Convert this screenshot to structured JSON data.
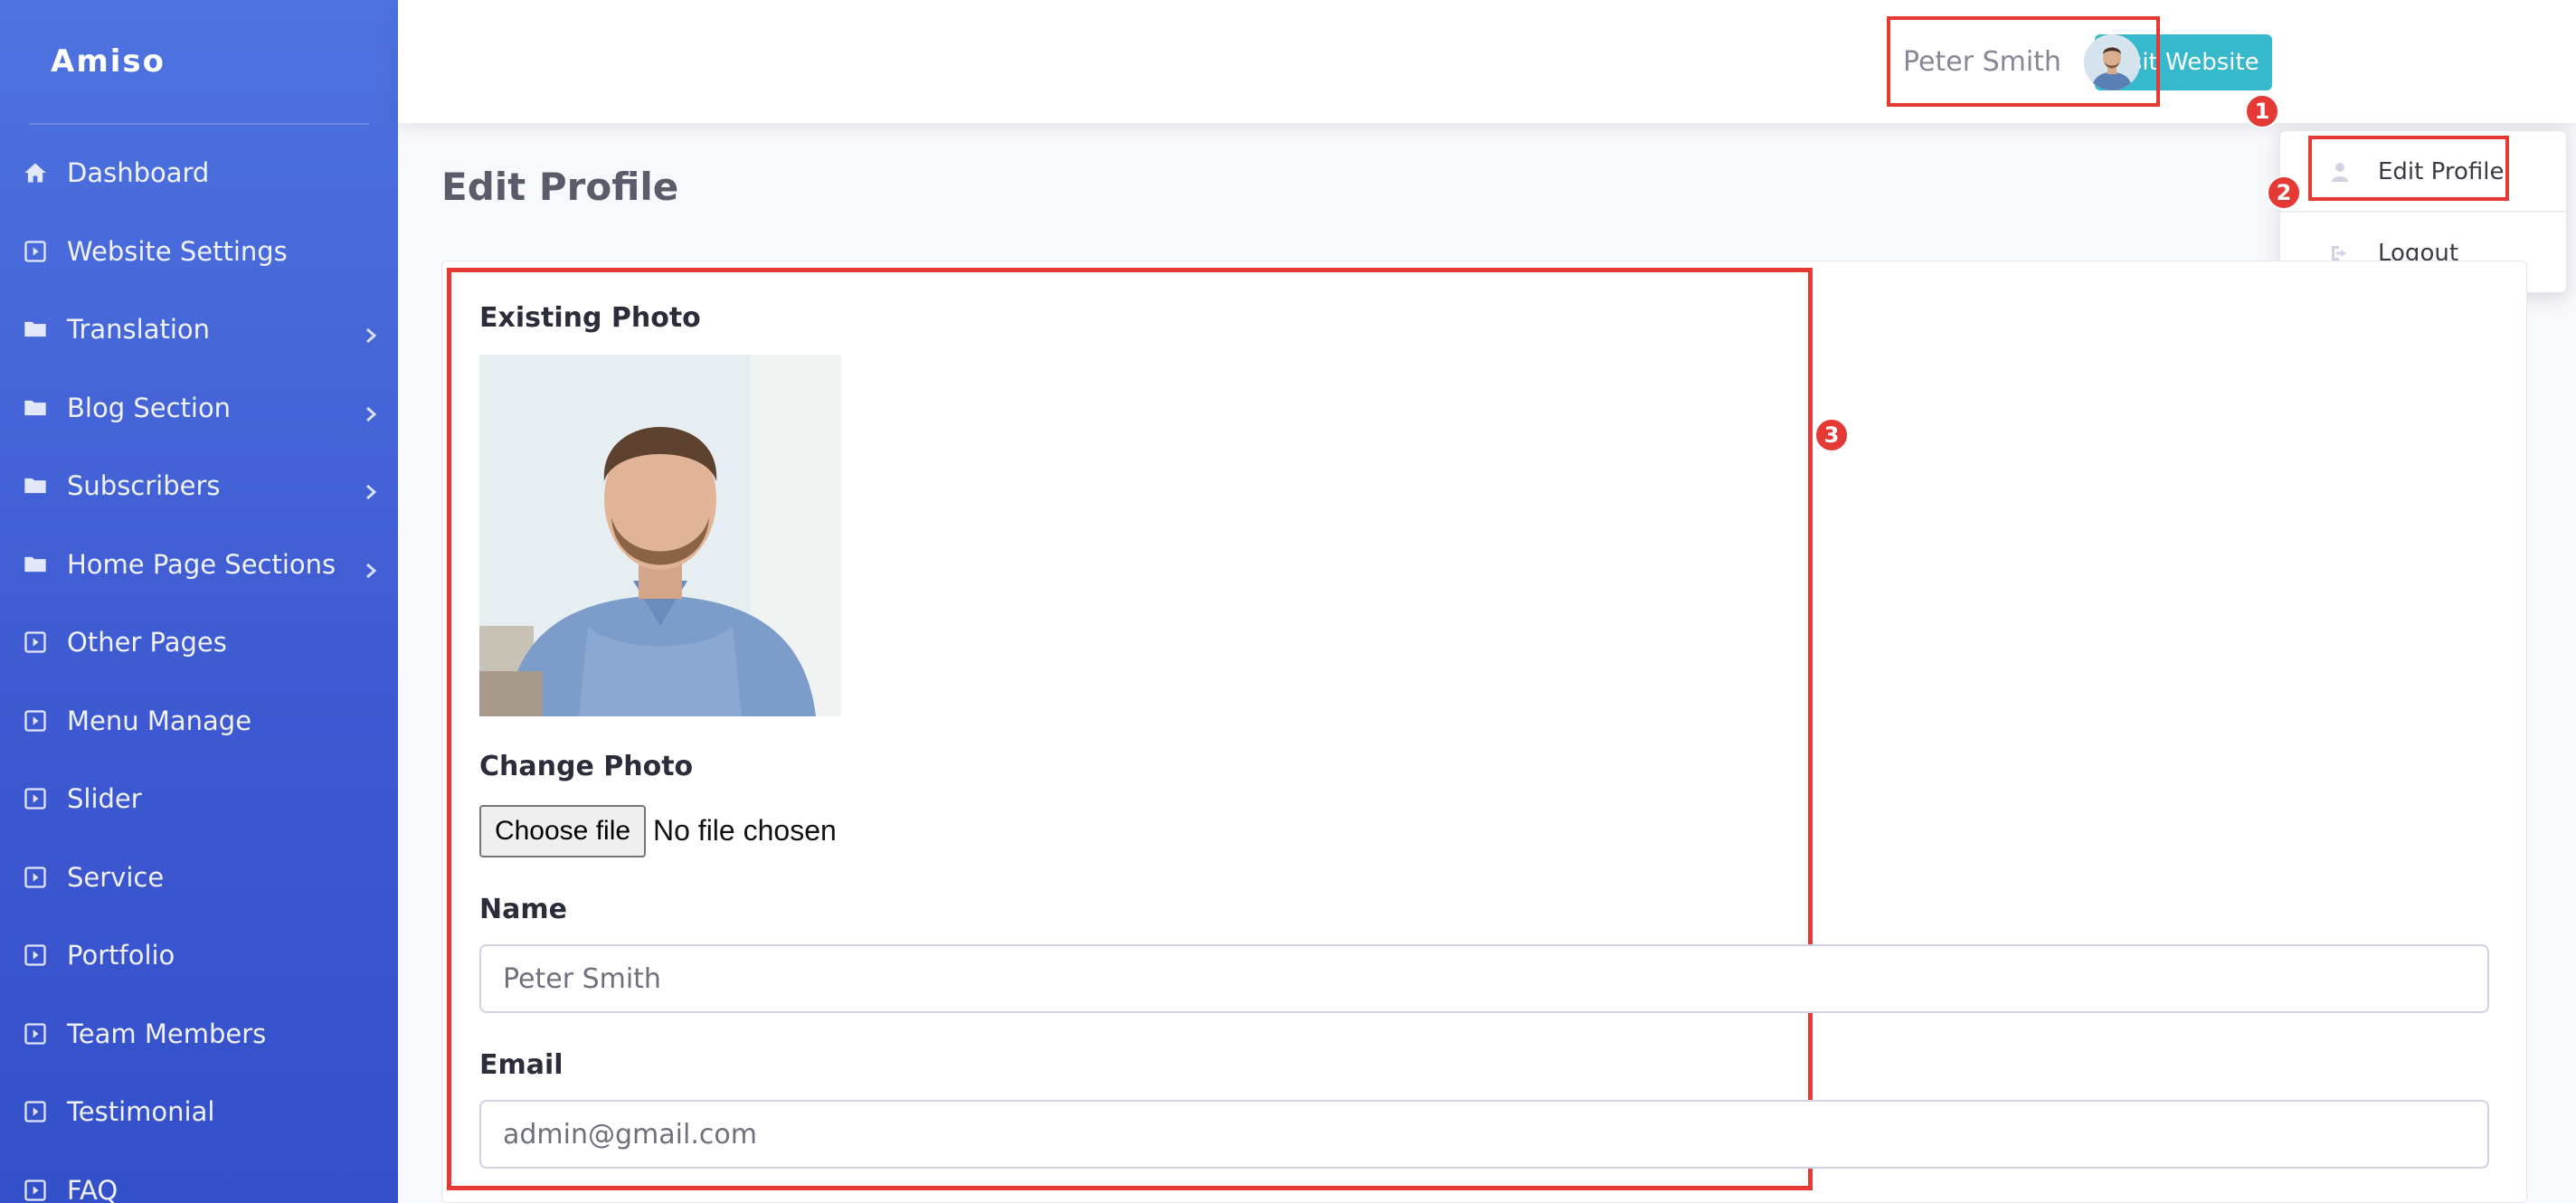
{
  "brand": "Amiso",
  "sidebar": {
    "items": [
      {
        "label": "Dashboard",
        "icon": "home-icon",
        "submenu": false
      },
      {
        "label": "Website Settings",
        "icon": "square-caret-icon",
        "submenu": false
      },
      {
        "label": "Translation",
        "icon": "folder-icon",
        "submenu": true
      },
      {
        "label": "Blog Section",
        "icon": "folder-icon",
        "submenu": true
      },
      {
        "label": "Subscribers",
        "icon": "folder-icon",
        "submenu": true
      },
      {
        "label": "Home Page Sections",
        "icon": "folder-icon",
        "submenu": true
      },
      {
        "label": "Other Pages",
        "icon": "square-caret-icon",
        "submenu": false
      },
      {
        "label": "Menu Manage",
        "icon": "square-caret-icon",
        "submenu": false
      },
      {
        "label": "Slider",
        "icon": "square-caret-icon",
        "submenu": false
      },
      {
        "label": "Service",
        "icon": "square-caret-icon",
        "submenu": false
      },
      {
        "label": "Portfolio",
        "icon": "square-caret-icon",
        "submenu": false
      },
      {
        "label": "Team Members",
        "icon": "square-caret-icon",
        "submenu": false
      },
      {
        "label": "Testimonial",
        "icon": "square-caret-icon",
        "submenu": false
      },
      {
        "label": "FAQ",
        "icon": "square-caret-icon",
        "submenu": false
      }
    ]
  },
  "topbar": {
    "visit_website": "Visit Website",
    "user_name": "Peter Smith"
  },
  "dropdown": {
    "edit_profile": "Edit Profile",
    "logout": "Logout"
  },
  "annotations": {
    "one": "1",
    "two": "2",
    "three": "3"
  },
  "page": {
    "title": "Edit Profile"
  },
  "form": {
    "existing_photo_label": "Existing Photo",
    "change_photo_label": "Change Photo",
    "choose_file": "Choose file",
    "no_file": "No file chosen",
    "name_label": "Name",
    "name_value": "Peter Smith",
    "email_label": "Email",
    "email_value": "admin@gmail.com"
  },
  "colors": {
    "sidebar": "#4e73df",
    "visit_button": "#36b9cc",
    "annotation": "#e53935"
  }
}
